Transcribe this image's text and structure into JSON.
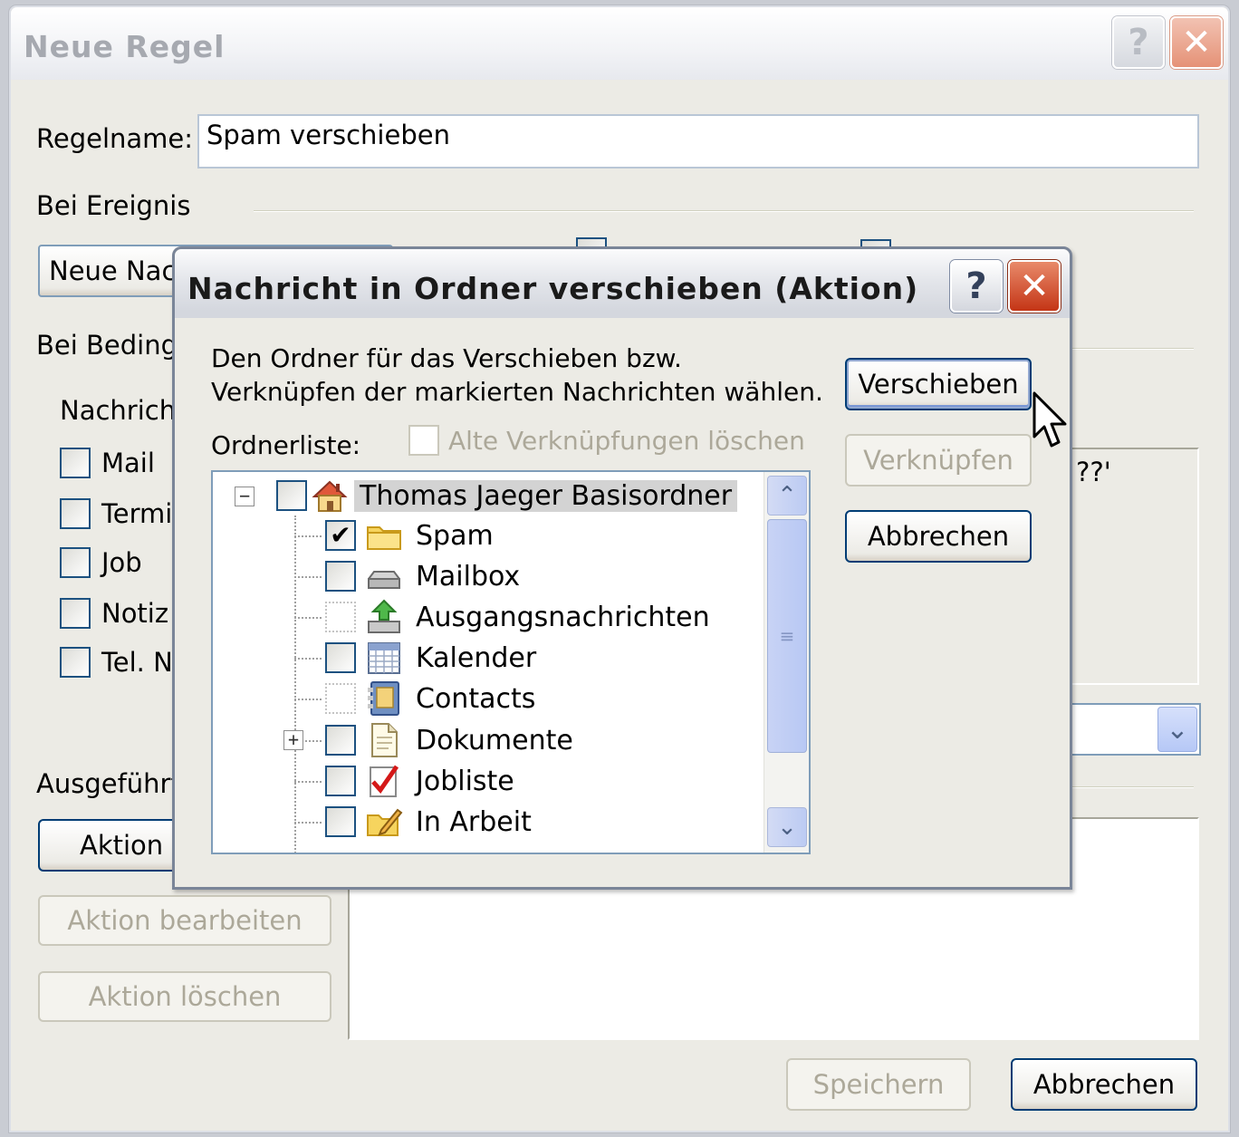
{
  "outer": {
    "title": "Neue Regel",
    "regelname_label": "Regelname:",
    "regelname_value": "Spam verschieben",
    "bei_ereignis": "Bei Ereignis",
    "event_select": "Neue Nac",
    "bei_bedingung": "Bei Beding",
    "nachricht_label": "Nachrich",
    "types": [
      {
        "label": "Mail"
      },
      {
        "label": "Termi"
      },
      {
        "label": "Job"
      },
      {
        "label": "Notiz"
      },
      {
        "label": "Tel. N"
      }
    ],
    "condition_text": "??'",
    "ausgefuehrte": "Ausgeführt",
    "aktion_hinzufuegen": "Aktion h",
    "aktion_bearbeiten": "Aktion bearbeiten",
    "aktion_loeschen": "Aktion löschen",
    "speichern": "Speichern",
    "abbrechen": "Abbrechen"
  },
  "dialog": {
    "title": "Nachricht in Ordner verschieben (Aktion)",
    "help_glyph": "?",
    "close_glyph": "✕",
    "instruction_line1": "Den Ordner für das Verschieben bzw.",
    "instruction_line2": "Verknüpfen der markierten Nachrichten wählen.",
    "ordnerliste_label": "Ordnerliste:",
    "alte_verknuepfungen": "Alte Verknüpfungen löschen",
    "verschieben": "Verschieben",
    "verknuepfen": "Verknüpfen",
    "abbrechen": "Abbrechen"
  },
  "tree": {
    "root": {
      "label": "Thomas Jaeger Basisordner",
      "icon": "house-icon",
      "checked": false
    },
    "children": [
      {
        "label": "Spam",
        "icon": "folder-icon",
        "checked": true
      },
      {
        "label": "Mailbox",
        "icon": "inbox-tray-icon",
        "checked": false
      },
      {
        "label": "Ausgangsnachrichten",
        "icon": "outbox-icon",
        "checked": false,
        "checkbox": "dotted"
      },
      {
        "label": "Kalender",
        "icon": "calendar-icon",
        "checked": false
      },
      {
        "label": "Contacts",
        "icon": "address-book-icon",
        "checked": false,
        "checkbox": "dotted"
      },
      {
        "label": "Dokumente",
        "icon": "document-icon",
        "checked": false,
        "expandable": true
      },
      {
        "label": "Jobliste",
        "icon": "checkmark-list-icon",
        "checked": false
      },
      {
        "label": "In Arbeit",
        "icon": "folder-edit-icon",
        "checked": false
      }
    ]
  },
  "glyphs": {
    "help": "?",
    "close": "✕",
    "chevron_down": "⌄",
    "collapse": "−",
    "expand": "+",
    "scroll_up": "⌃",
    "scroll_down": "⌄",
    "grip": "≡"
  },
  "colors": {
    "xp_blue_border": "#003c74",
    "close_red": "#c43516",
    "selection_gray": "#d3d3d3"
  }
}
